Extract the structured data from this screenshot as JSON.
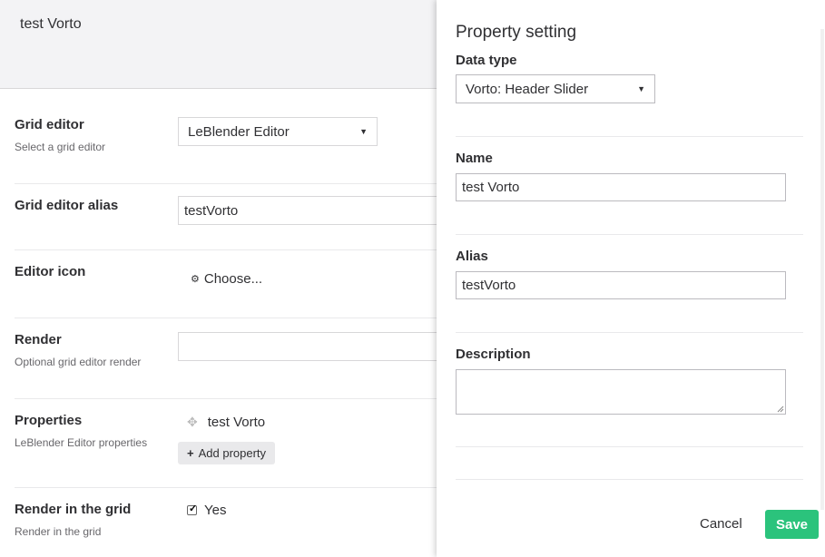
{
  "background": {
    "header_title": "test Vorto",
    "rows": {
      "grid_editor": {
        "label": "Grid editor",
        "desc": "Select a grid editor",
        "value": "LeBlender Editor"
      },
      "alias": {
        "label": "Grid editor alias",
        "value": "testVorto"
      },
      "icon": {
        "label": "Editor icon",
        "choose_label": "Choose..."
      },
      "render": {
        "label": "Render",
        "desc": "Optional grid editor render",
        "value": ""
      },
      "properties": {
        "label": "Properties",
        "desc": "LeBlender Editor properties",
        "item": "test Vorto",
        "add_label": "Add property"
      },
      "render_in_grid": {
        "label": "Render in the grid",
        "desc": "Render in the grid",
        "checkbox_label": "Yes",
        "checked": true
      }
    }
  },
  "overlay": {
    "title": "Property setting",
    "data_type_label": "Data type",
    "data_type_value": "Vorto: Header Slider",
    "name_label": "Name",
    "name_value": "test Vorto",
    "alias_label": "Alias",
    "alias_value": "testVorto",
    "description_label": "Description",
    "description_value": "",
    "cancel_label": "Cancel",
    "save_label": "Save"
  },
  "colors": {
    "save_button": "#2bc37c",
    "header_bg": "#f3f3f5",
    "text": "#303033"
  }
}
